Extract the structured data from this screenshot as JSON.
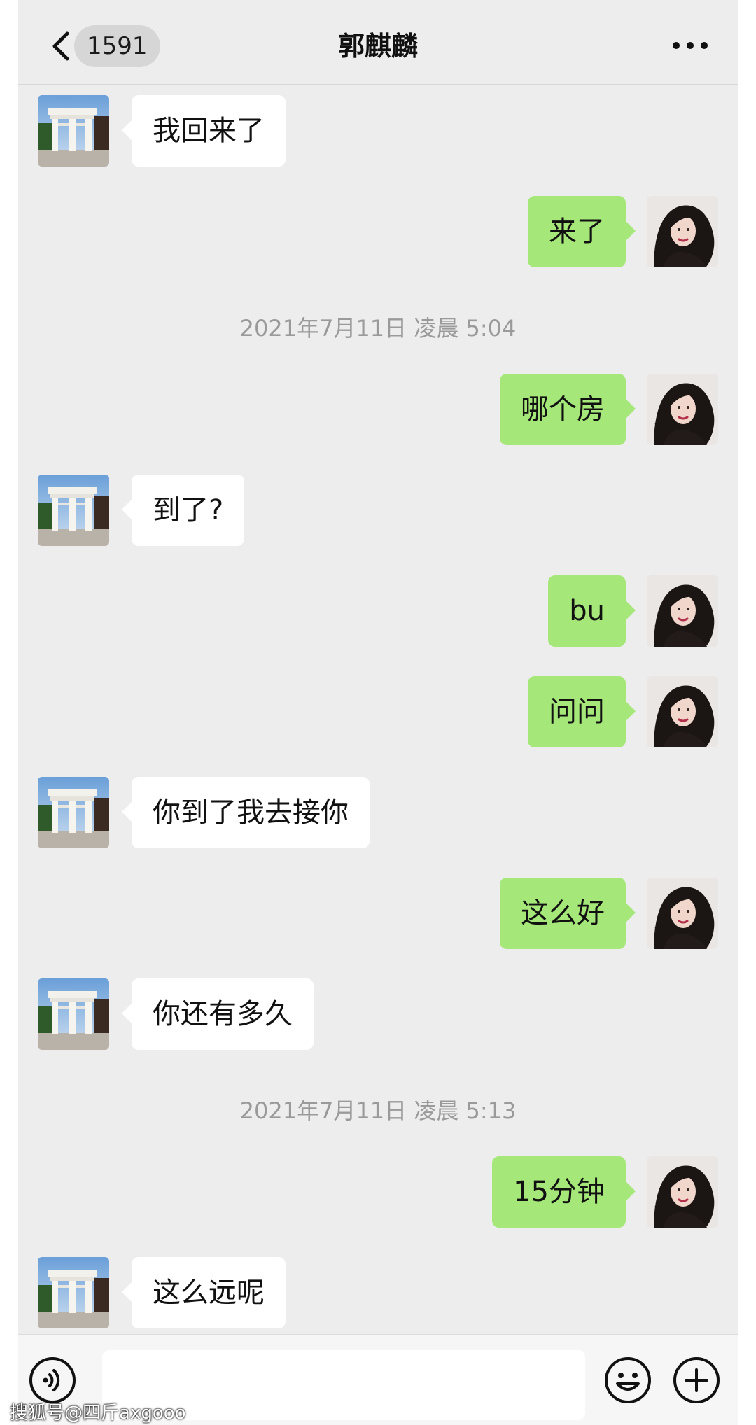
{
  "header": {
    "back_icon": "chevron-left-icon",
    "unread_count": "1591",
    "title": "郭麒麟",
    "more_icon": "more-dots-icon"
  },
  "colors": {
    "background": "#ededed",
    "outgoing_bubble": "#a5e879",
    "incoming_bubble": "#ffffff",
    "timestamp_text": "#9a9a9a"
  },
  "messages": [
    {
      "from": "contact",
      "text": "我回来了"
    },
    {
      "from": "me",
      "text": "来了"
    },
    {
      "timestamp": "2021年7月11日 凌晨 5:04"
    },
    {
      "from": "me",
      "text": "哪个房"
    },
    {
      "from": "contact",
      "text": "到了?"
    },
    {
      "from": "me",
      "text": "bu"
    },
    {
      "from": "me",
      "text": "问问"
    },
    {
      "from": "contact",
      "text": "你到了我去接你"
    },
    {
      "from": "me",
      "text": "这么好"
    },
    {
      "from": "contact",
      "text": "你还有多久"
    },
    {
      "timestamp": "2021年7月11日 凌晨 5:13"
    },
    {
      "from": "me",
      "text": "15分钟"
    },
    {
      "from": "contact",
      "text": "这么远呢"
    }
  ],
  "inputbar": {
    "voice_icon": "voice-icon",
    "input_value": "",
    "emoji_icon": "emoji-icon",
    "plus_icon": "plus-icon"
  },
  "watermark": "搜狐号@四斤axgooo"
}
